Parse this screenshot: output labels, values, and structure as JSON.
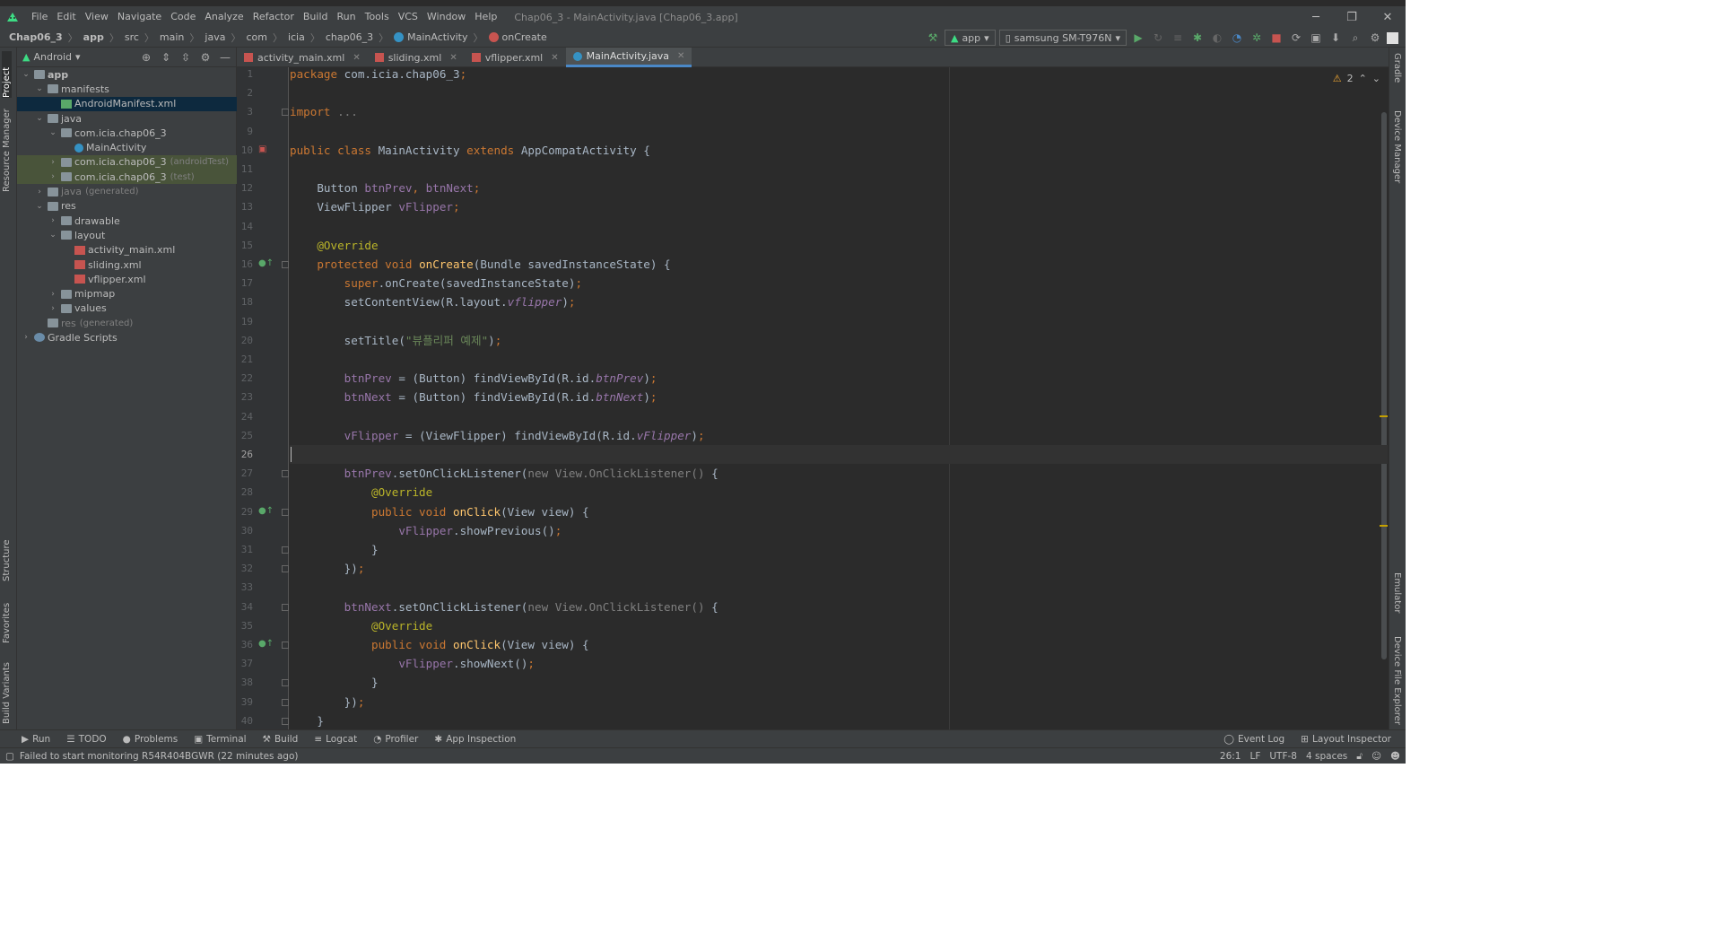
{
  "titlebar": {
    "menus": [
      "File",
      "Edit",
      "View",
      "Navigate",
      "Code",
      "Analyze",
      "Refactor",
      "Build",
      "Run",
      "Tools",
      "VCS",
      "Window",
      "Help"
    ],
    "window_title": "Chap06_3 - MainActivity.java [Chap06_3.app]",
    "controls": [
      "─",
      "❐",
      "✕"
    ]
  },
  "breadcrumb": {
    "items": [
      "Chap06_3",
      "app",
      "src",
      "main",
      "java",
      "com",
      "icia",
      "chap06_3",
      "MainActivity",
      "onCreate"
    ]
  },
  "toolbar": {
    "run_config": "app",
    "device": "samsung SM-T976N"
  },
  "left_stripe": {
    "tabs": [
      "Project",
      "Resource Manager",
      "Structure",
      "Favorites",
      "Build Variants"
    ]
  },
  "right_stripe": {
    "tabs": [
      "Gradle",
      "Device Manager",
      "Emulator",
      "Device File Explorer"
    ]
  },
  "project_panel": {
    "view_mode": "Android",
    "tree": [
      {
        "label": "app",
        "extra": "",
        "depth": 0,
        "expanded": true,
        "icon": "module-icon"
      },
      {
        "label": "manifests",
        "extra": "",
        "depth": 1,
        "expanded": true,
        "icon": "folder-icon"
      },
      {
        "label": "AndroidManifest.xml",
        "extra": "",
        "depth": 2,
        "expanded": null,
        "icon": "manifest-icon",
        "selected": true
      },
      {
        "label": "java",
        "extra": "",
        "depth": 1,
        "expanded": true,
        "icon": "folder-icon"
      },
      {
        "label": "com.icia.chap06_3",
        "extra": "",
        "depth": 2,
        "expanded": true,
        "icon": "package-icon"
      },
      {
        "label": "MainActivity",
        "extra": "",
        "depth": 3,
        "expanded": null,
        "icon": "java-class-icon"
      },
      {
        "label": "com.icia.chap06_3",
        "extra": "(androidTest)",
        "depth": 2,
        "expanded": false,
        "icon": "package-icon",
        "test": true
      },
      {
        "label": "com.icia.chap06_3",
        "extra": "(test)",
        "depth": 2,
        "expanded": false,
        "icon": "package-icon",
        "test": true
      },
      {
        "label": "java",
        "extra": "(generated)",
        "depth": 1,
        "expanded": false,
        "icon": "folder-icon"
      },
      {
        "label": "res",
        "extra": "",
        "depth": 1,
        "expanded": true,
        "icon": "folder-icon"
      },
      {
        "label": "drawable",
        "extra": "",
        "depth": 2,
        "expanded": false,
        "icon": "folder-icon"
      },
      {
        "label": "layout",
        "extra": "",
        "depth": 2,
        "expanded": true,
        "icon": "folder-icon"
      },
      {
        "label": "activity_main.xml",
        "extra": "",
        "depth": 3,
        "expanded": null,
        "icon": "xml-icon"
      },
      {
        "label": "sliding.xml",
        "extra": "",
        "depth": 3,
        "expanded": null,
        "icon": "xml-icon"
      },
      {
        "label": "vflipper.xml",
        "extra": "",
        "depth": 3,
        "expanded": null,
        "icon": "xml-icon"
      },
      {
        "label": "mipmap",
        "extra": "",
        "depth": 2,
        "expanded": false,
        "icon": "folder-icon"
      },
      {
        "label": "values",
        "extra": "",
        "depth": 2,
        "expanded": false,
        "icon": "folder-icon"
      },
      {
        "label": "res",
        "extra": "(generated)",
        "depth": 1,
        "expanded": null,
        "icon": "folder-icon"
      },
      {
        "label": "Gradle Scripts",
        "extra": "",
        "depth": 0,
        "expanded": false,
        "icon": "gradle-icon"
      }
    ]
  },
  "editor_tabs": [
    {
      "label": "activity_main.xml",
      "active": false,
      "icon": "xml-icon"
    },
    {
      "label": "sliding.xml",
      "active": false,
      "icon": "xml-icon"
    },
    {
      "label": "vflipper.xml",
      "active": false,
      "icon": "xml-icon"
    },
    {
      "label": "MainActivity.java",
      "active": true,
      "icon": "java-class-icon"
    }
  ],
  "editor": {
    "warning_count": "2",
    "current_line": 26,
    "lines": [
      {
        "n": "1",
        "code": [
          [
            "kw",
            "package "
          ],
          [
            "",
            "com.icia.chap06_3"
          ],
          [
            "kw",
            ";"
          ]
        ]
      },
      {
        "n": "2",
        "code": []
      },
      {
        "n": "3",
        "code": [
          [
            "kw",
            "import "
          ],
          [
            "gray",
            "..."
          ]
        ],
        "fold": true
      },
      {
        "n": "9",
        "code": []
      },
      {
        "n": "10",
        "code": [
          [
            "kw",
            "public class "
          ],
          [
            "",
            "MainActivity "
          ],
          [
            "kw",
            "extends "
          ],
          [
            "",
            "AppCompatActivity {"
          ]
        ]
      },
      {
        "n": "11",
        "code": []
      },
      {
        "n": "12",
        "code": [
          [
            "",
            "    Button "
          ],
          [
            "fld",
            "btnPrev"
          ],
          [
            "kw",
            ", "
          ],
          [
            "fld",
            "btnNext"
          ],
          [
            "kw",
            ";"
          ]
        ]
      },
      {
        "n": "13",
        "code": [
          [
            "",
            "    ViewFlipper "
          ],
          [
            "fld",
            "vFlipper"
          ],
          [
            "kw",
            ";"
          ]
        ]
      },
      {
        "n": "14",
        "code": []
      },
      {
        "n": "15",
        "code": [
          [
            "ann",
            "    @Override"
          ]
        ]
      },
      {
        "n": "16",
        "code": [
          [
            "kw",
            "    protected void "
          ],
          [
            "fn",
            "onCreate"
          ],
          [
            "",
            "(Bundle savedInstanceState) {"
          ]
        ],
        "fold": true,
        "mark": true
      },
      {
        "n": "17",
        "code": [
          [
            "kw",
            "        super"
          ],
          [
            "",
            ".onCreate(savedInstanceState)"
          ],
          [
            "kw",
            ";"
          ]
        ]
      },
      {
        "n": "18",
        "code": [
          [
            "",
            "        setContentView(R.layout."
          ],
          [
            "fldi",
            "vflipper"
          ],
          [
            "",
            ")"
          ],
          [
            "kw",
            ";"
          ]
        ]
      },
      {
        "n": "19",
        "code": []
      },
      {
        "n": "20",
        "code": [
          [
            "",
            "        setTitle("
          ],
          [
            "str",
            "\"뷰플리퍼 예제\""
          ],
          [
            "",
            ")"
          ],
          [
            "kw",
            ";"
          ]
        ]
      },
      {
        "n": "21",
        "code": []
      },
      {
        "n": "22",
        "code": [
          [
            "",
            "        "
          ],
          [
            "fld",
            "btnPrev "
          ],
          [
            "",
            "= (Button) findViewById(R.id."
          ],
          [
            "fldi",
            "btnPrev"
          ],
          [
            "",
            ")"
          ],
          [
            "kw",
            ";"
          ]
        ]
      },
      {
        "n": "23",
        "code": [
          [
            "",
            "        "
          ],
          [
            "fld",
            "btnNext "
          ],
          [
            "",
            "= (Button) findViewById(R.id."
          ],
          [
            "fldi",
            "btnNext"
          ],
          [
            "",
            ")"
          ],
          [
            "kw",
            ";"
          ]
        ]
      },
      {
        "n": "24",
        "code": []
      },
      {
        "n": "25",
        "code": [
          [
            "",
            "        "
          ],
          [
            "fld",
            "vFlipper "
          ],
          [
            "",
            "= (ViewFlipper) findViewById(R.id."
          ],
          [
            "fldi",
            "vFlipper"
          ],
          [
            "",
            ")"
          ],
          [
            "kw",
            ";"
          ]
        ]
      },
      {
        "n": "26",
        "code": []
      },
      {
        "n": "27",
        "code": [
          [
            "",
            "        "
          ],
          [
            "fld",
            "btnPrev"
          ],
          [
            "",
            ".setOnClickListener("
          ],
          [
            "gray",
            "new View.OnClickListener() "
          ],
          [
            "",
            "{"
          ]
        ],
        "fold": true
      },
      {
        "n": "28",
        "code": [
          [
            "ann",
            "            @Override"
          ]
        ]
      },
      {
        "n": "29",
        "code": [
          [
            "kw",
            "            public void "
          ],
          [
            "fn",
            "onClick"
          ],
          [
            "",
            "(View view) {"
          ]
        ],
        "fold": true,
        "mark": true
      },
      {
        "n": "30",
        "code": [
          [
            "",
            "                "
          ],
          [
            "fld",
            "vFlipper"
          ],
          [
            "",
            ".showPrevious()"
          ],
          [
            "kw",
            ";"
          ]
        ]
      },
      {
        "n": "31",
        "code": [
          [
            "",
            "            }"
          ]
        ],
        "fold": true
      },
      {
        "n": "32",
        "code": [
          [
            "",
            "        })"
          ],
          [
            "kw",
            ";"
          ]
        ],
        "fold": true
      },
      {
        "n": "33",
        "code": []
      },
      {
        "n": "34",
        "code": [
          [
            "",
            "        "
          ],
          [
            "fld",
            "btnNext"
          ],
          [
            "",
            ".setOnClickListener("
          ],
          [
            "gray",
            "new View.OnClickListener() "
          ],
          [
            "",
            "{"
          ]
        ],
        "fold": true
      },
      {
        "n": "35",
        "code": [
          [
            "ann",
            "            @Override"
          ]
        ]
      },
      {
        "n": "36",
        "code": [
          [
            "kw",
            "            public void "
          ],
          [
            "fn",
            "onClick"
          ],
          [
            "",
            "(View view) {"
          ]
        ],
        "fold": true,
        "mark": true
      },
      {
        "n": "37",
        "code": [
          [
            "",
            "                "
          ],
          [
            "fld",
            "vFlipper"
          ],
          [
            "",
            ".showNext()"
          ],
          [
            "kw",
            ";"
          ]
        ]
      },
      {
        "n": "38",
        "code": [
          [
            "",
            "            }"
          ]
        ],
        "fold": true
      },
      {
        "n": "39",
        "code": [
          [
            "",
            "        })"
          ],
          [
            "kw",
            ";"
          ]
        ],
        "fold": true
      },
      {
        "n": "40",
        "code": [
          [
            "",
            "    }"
          ]
        ],
        "fold": true
      }
    ]
  },
  "bottom_tools": {
    "left": [
      "Run",
      "TODO",
      "Problems",
      "Terminal",
      "Build",
      "Logcat",
      "Profiler",
      "App Inspection"
    ],
    "right": [
      "Event Log",
      "Layout Inspector"
    ]
  },
  "status": {
    "message": "Failed to start monitoring R54R404BGWR (22 minutes ago)",
    "position": "26:1",
    "line_ending": "LF",
    "encoding": "UTF-8",
    "indent": "4 spaces"
  },
  "colors": {
    "keyword": "#cc7832",
    "annotation": "#bbb529",
    "function": "#ffc66d",
    "field": "#9876aa",
    "string": "#6a8759",
    "accent": "#4a88c7"
  }
}
